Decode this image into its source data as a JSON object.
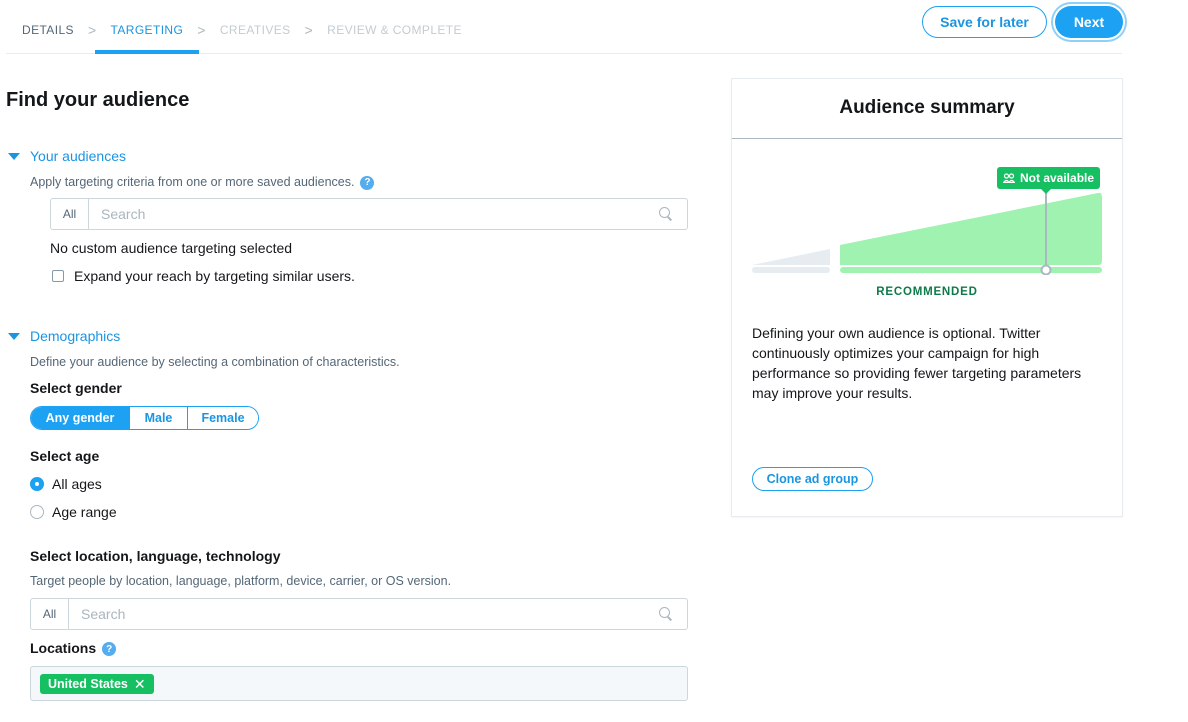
{
  "stepper": {
    "steps": [
      {
        "label": "Details",
        "state": "done"
      },
      {
        "label": "Targeting",
        "state": "active"
      },
      {
        "label": "Creatives",
        "state": "future"
      },
      {
        "label": "Review & Complete",
        "state": "future"
      }
    ],
    "separator": ">"
  },
  "actions": {
    "save_label": "Save for later",
    "next_label": "Next"
  },
  "page": {
    "title": "Find your audience"
  },
  "your_audiences": {
    "heading": "Your audiences",
    "help": "Apply targeting criteria from one or more saved audiences.",
    "help_icon": "question-icon",
    "search": {
      "scope": "All",
      "placeholder": "Search"
    },
    "status": "No custom audience targeting selected",
    "expand_checkbox": {
      "label": "Expand your reach by targeting similar users.",
      "checked": false
    }
  },
  "demographics": {
    "heading": "Demographics",
    "help": "Define your audience by selecting a combination of characteristics.",
    "gender": {
      "label": "Select gender",
      "options": [
        "Any gender",
        "Male",
        "Female"
      ],
      "selected": "Any gender"
    },
    "age": {
      "label": "Select age",
      "options": [
        "All ages",
        "Age range"
      ],
      "selected": "All ages"
    },
    "location": {
      "label": "Select location, language, technology",
      "help": "Target people by location, language, platform, device, carrier, or OS version.",
      "search": {
        "scope": "All",
        "placeholder": "Search"
      },
      "locations_label": "Locations",
      "locations": [
        "United States"
      ]
    }
  },
  "summary": {
    "title": "Audience summary",
    "tooltip": "Not available",
    "tooltip_icon": "people-icon",
    "recommended_label": "RECOMMENDED",
    "description": "Defining your own audience is optional. Twitter continuously optimizes your campaign for high performance so providing fewer targeting parameters may improve your results.",
    "clone_label": "Clone ad group",
    "colors": {
      "accent": "#1da1f2",
      "recommended_fill": "#a0f2b0",
      "tag_green": "#17bf63",
      "inactive": "#e6ecf0"
    }
  }
}
